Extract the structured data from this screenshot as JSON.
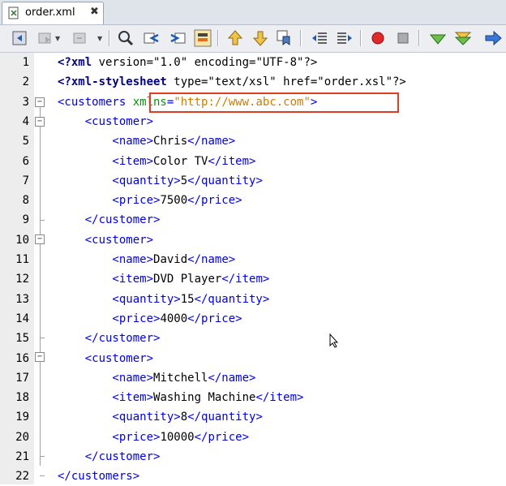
{
  "tab": {
    "title": "order.xml",
    "close": "✖",
    "icon": "xml-file-icon"
  },
  "toolbar": {
    "buttons": [
      "back-icon",
      "forward-disabled-icon",
      "history-disabled-icon",
      "find-icon",
      "find-previous-icon",
      "find-next-icon",
      "toggle-highlight-icon",
      "previous-bookmark-icon",
      "next-bookmark-icon",
      "toggle-bookmark-icon",
      "shift-left-icon",
      "shift-right-icon",
      "record-macro-icon",
      "stop-macro-icon",
      "check-xml-icon",
      "validate-xml-icon",
      "xsl-transform-icon"
    ]
  },
  "code": {
    "lines": [
      {
        "n": "1",
        "t": [
          [
            "pi",
            "<?xml"
          ],
          [
            "txt",
            " version=\"1.0\" encoding=\"UTF-8\"?>"
          ]
        ]
      },
      {
        "n": "2",
        "t": [
          [
            "pi",
            "<?xml-stylesheet"
          ],
          [
            "txt",
            " type=\"text/xsl\" href=\"order.xsl\"?>"
          ]
        ]
      },
      {
        "n": "3",
        "t": [
          [
            "tag",
            "<customers "
          ],
          [
            "ns-attr",
            "xmlns"
          ],
          [
            "tag",
            "="
          ],
          [
            "val",
            "\"http://www.abc.com\""
          ],
          [
            "tag",
            ">"
          ]
        ]
      },
      {
        "n": "4",
        "t": [
          [
            "tag",
            "    <customer>"
          ]
        ]
      },
      {
        "n": "5",
        "t": [
          [
            "tag",
            "        <name>"
          ],
          [
            "txt",
            "Chris"
          ],
          [
            "tag",
            "</name>"
          ]
        ]
      },
      {
        "n": "6",
        "t": [
          [
            "tag",
            "        <item>"
          ],
          [
            "txt",
            "Color TV"
          ],
          [
            "tag",
            "</item>"
          ]
        ]
      },
      {
        "n": "7",
        "t": [
          [
            "tag",
            "        <quantity>"
          ],
          [
            "txt",
            "5"
          ],
          [
            "tag",
            "</quantity>"
          ]
        ]
      },
      {
        "n": "8",
        "t": [
          [
            "tag",
            "        <price>"
          ],
          [
            "txt",
            "7500"
          ],
          [
            "tag",
            "</price>"
          ]
        ]
      },
      {
        "n": "9",
        "t": [
          [
            "tag",
            "    </customer>"
          ]
        ]
      },
      {
        "n": "10",
        "t": [
          [
            "tag",
            "    <customer>"
          ]
        ]
      },
      {
        "n": "11",
        "t": [
          [
            "tag",
            "        <name>"
          ],
          [
            "txt",
            "David"
          ],
          [
            "tag",
            "</name>"
          ]
        ]
      },
      {
        "n": "12",
        "t": [
          [
            "tag",
            "        <item>"
          ],
          [
            "txt",
            "DVD Player"
          ],
          [
            "tag",
            "</item>"
          ]
        ]
      },
      {
        "n": "13",
        "t": [
          [
            "tag",
            "        <quantity>"
          ],
          [
            "txt",
            "15"
          ],
          [
            "tag",
            "</quantity>"
          ]
        ]
      },
      {
        "n": "14",
        "t": [
          [
            "tag",
            "        <price>"
          ],
          [
            "txt",
            "4000"
          ],
          [
            "tag",
            "</price>"
          ]
        ]
      },
      {
        "n": "15",
        "t": [
          [
            "tag",
            "    </customer>"
          ]
        ]
      },
      {
        "n": "16",
        "t": [
          [
            "tag",
            "    <customer>"
          ]
        ]
      },
      {
        "n": "17",
        "t": [
          [
            "tag",
            "        <name>"
          ],
          [
            "txt",
            "Mitchell"
          ],
          [
            "tag",
            "</name>"
          ]
        ]
      },
      {
        "n": "18",
        "t": [
          [
            "tag",
            "        <item>"
          ],
          [
            "txt",
            "Washing Machine"
          ],
          [
            "tag",
            "</item>"
          ]
        ]
      },
      {
        "n": "19",
        "t": [
          [
            "tag",
            "        <quantity>"
          ],
          [
            "txt",
            "8"
          ],
          [
            "tag",
            "</quantity>"
          ]
        ]
      },
      {
        "n": "20",
        "t": [
          [
            "tag",
            "        <price>"
          ],
          [
            "txt",
            "10000"
          ],
          [
            "tag",
            "</price>"
          ]
        ]
      },
      {
        "n": "21",
        "t": [
          [
            "tag",
            "    </customer>"
          ]
        ]
      },
      {
        "n": "22",
        "t": [
          [
            "tag",
            "</customers>"
          ]
        ]
      }
    ]
  },
  "colors": {
    "tag": "#0000e6",
    "value": "#ce7b00",
    "namespace_attr": "#009900",
    "highlight_border": "#e03c22"
  }
}
